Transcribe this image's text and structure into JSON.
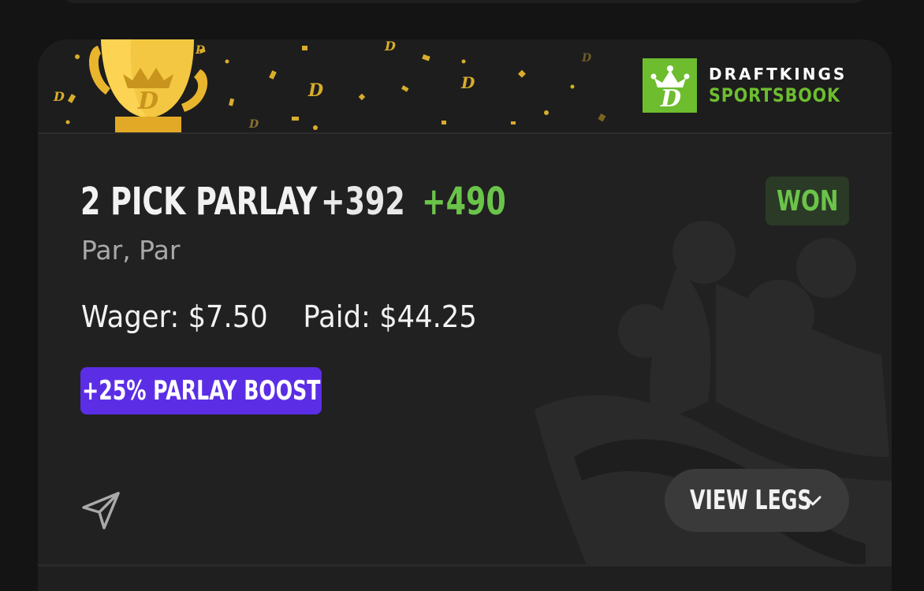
{
  "brand": {
    "line1": "DRAFTKINGS",
    "line2": "SPORTSBOOK",
    "accent_color": "#6dbd2f"
  },
  "bet": {
    "title": "2 PICK PARLAY",
    "original_odds": "+392",
    "boosted_odds": "+490",
    "status": "WON",
    "legs_summary": "Par, Par",
    "wager_label": "Wager:",
    "wager_amount": "$7.50",
    "paid_label": "Paid:",
    "paid_amount": "$44.25",
    "boost_label": "+25% PARLAY BOOST"
  },
  "actions": {
    "view_legs_label": "VIEW LEGS",
    "share_icon": "share-paper-plane-icon",
    "chevron_icon": "chevron-down-icon"
  },
  "colors": {
    "win_green": "#6bc44a",
    "boost_purple": "#5b2ee6",
    "card_bg": "#212121",
    "trophy_gold": "#f0c33c"
  }
}
